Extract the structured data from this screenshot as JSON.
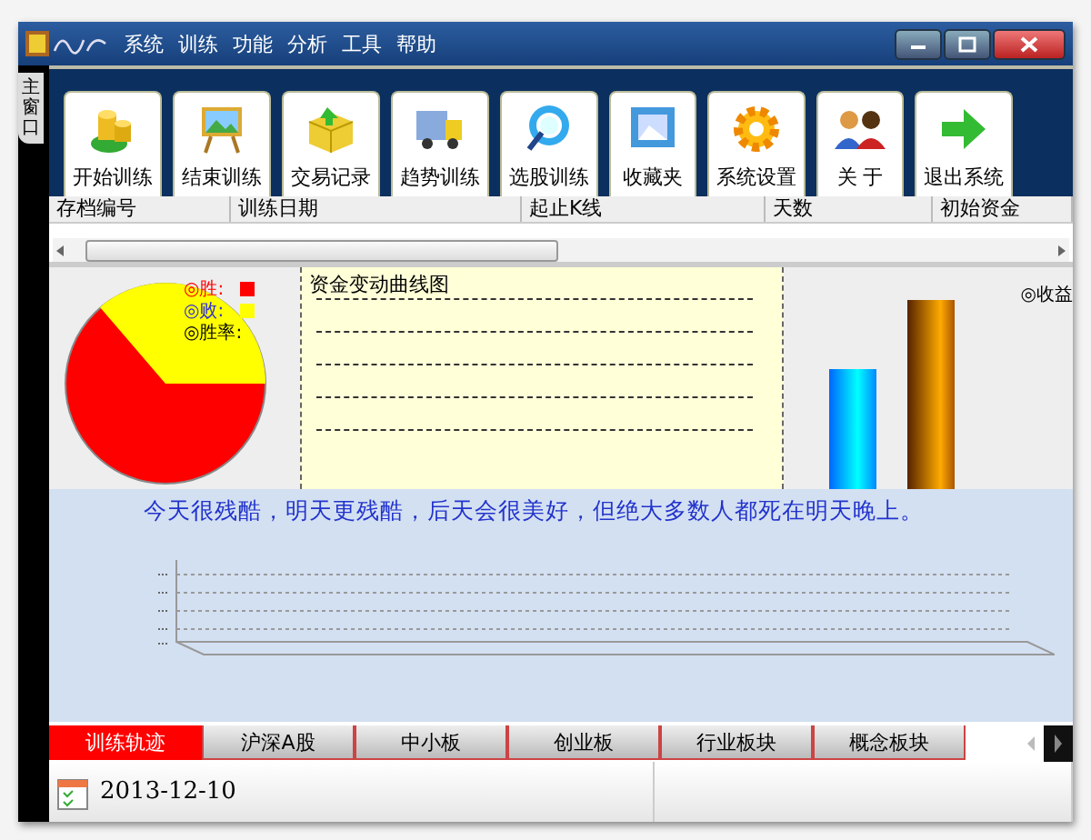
{
  "window": {
    "menu": [
      "系统",
      "训练",
      "功能",
      "分析",
      "工具",
      "帮助"
    ]
  },
  "side_tab": {
    "label": "主窗口"
  },
  "toolbar": [
    {
      "label": "开始训练",
      "kind": "coins"
    },
    {
      "label": "结束训练",
      "kind": "easel"
    },
    {
      "label": "交易记录",
      "kind": "box"
    },
    {
      "label": "趋势训练",
      "kind": "truck"
    },
    {
      "label": "选股训练",
      "kind": "magnifier"
    },
    {
      "label": "收藏夹",
      "kind": "picture"
    },
    {
      "label": "系统设置",
      "kind": "gear"
    },
    {
      "label": "关 于",
      "kind": "people"
    },
    {
      "label": "退出系统",
      "kind": "arrow"
    }
  ],
  "table": {
    "columns": [
      "存档编号",
      "训练日期",
      "起止K线",
      "天数",
      "初始资金"
    ]
  },
  "pie_legend": [
    {
      "label": "◎胜:",
      "color": "#ff0000"
    },
    {
      "label": "◎败:",
      "color": "#ffff00"
    },
    {
      "label": "◎胜率:"
    }
  ],
  "curve_panel": {
    "title": "资金变动曲线图"
  },
  "bar_panel": {
    "label": "◎收益"
  },
  "quote": "今天很残酷，明天更残酷，后天会很美好，但绝大多数人都死在明天晚上。",
  "bottom_tabs": [
    {
      "label": "训练轨迹",
      "selected": true
    },
    {
      "label": "沪深A股",
      "selected": false
    },
    {
      "label": "中小板",
      "selected": false
    },
    {
      "label": "创业板",
      "selected": false
    },
    {
      "label": "行业板块",
      "selected": false
    },
    {
      "label": "概念板块",
      "selected": false
    }
  ],
  "status_bar": {
    "date": "2013-12-10"
  }
}
